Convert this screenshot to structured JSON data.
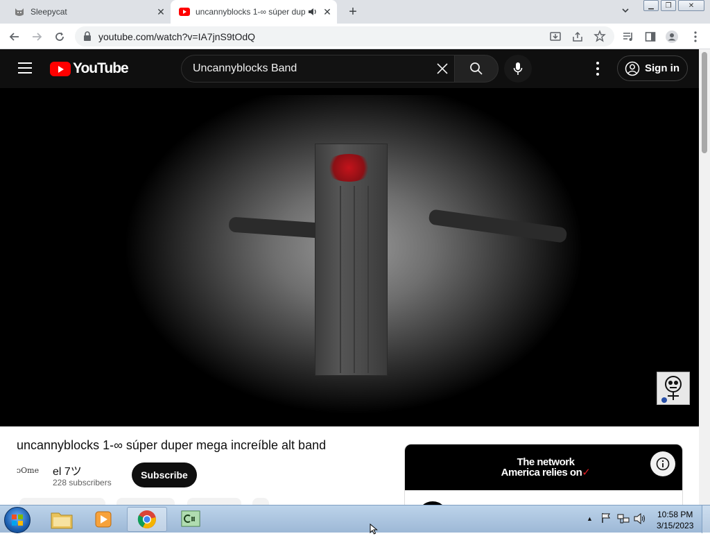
{
  "browser": {
    "tabs": [
      {
        "title": "Sleepycat",
        "active": false
      },
      {
        "title": "uncannyblocks 1-∞ súper duper mega increíble alt band",
        "active": true
      }
    ],
    "url": "youtube.com/watch?v=IA7jnS9tOdQ"
  },
  "youtube": {
    "logo_text": "YouTube",
    "search_value": "Uncannyblocks Band",
    "sign_in": "Sign in"
  },
  "video": {
    "title": "uncannyblocks 1-∞ súper duper mega increíble alt band",
    "channel_name": "el 7ツ",
    "subscribers": "228 subscribers",
    "subscribe_label": "Subscribe",
    "channel_avatar_text": "ᴐOme"
  },
  "ad": {
    "headline_line1": "The network",
    "headline_line2": "America relies on"
  },
  "taskbar": {
    "time": "10:58 PM",
    "date": "3/15/2023"
  },
  "colors": {
    "yt_red": "#ff0000",
    "yt_dark": "#0f0f0f",
    "creature_eye": "#c4131b"
  }
}
